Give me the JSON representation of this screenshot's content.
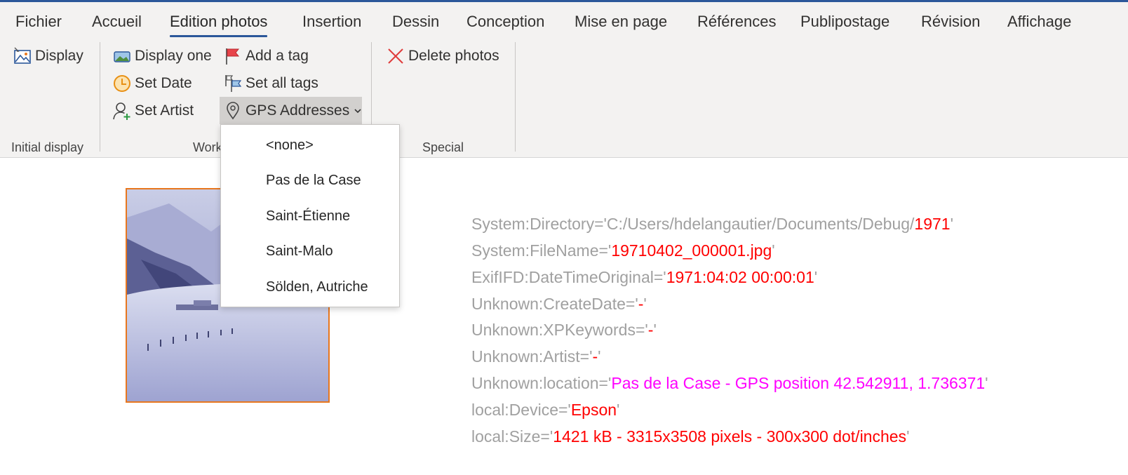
{
  "tabs": [
    "Fichier",
    "Accueil",
    "Edition photos",
    "Insertion",
    "Dessin",
    "Conception",
    "Mise en page",
    "Références",
    "Publipostage",
    "Révision",
    "Affichage"
  ],
  "active_tab": "Edition photos",
  "ribbon": {
    "display": "Display",
    "display_one": "Display one",
    "add_tag": "Add a tag",
    "set_date": "Set Date",
    "set_all_tags": "Set all tags",
    "set_artist": "Set Artist",
    "gps_addresses": "GPS Addresses",
    "delete_photos": "Delete photos",
    "group_initial": "Initial display",
    "group_work": "Work",
    "group_special": "Special"
  },
  "gps_menu": {
    "items": [
      "<none>",
      "Pas de la Case",
      "Saint-Étienne",
      "Saint-Malo",
      "Sölden, Autriche"
    ]
  },
  "metadata": [
    {
      "key": "System:Directory='",
      "value": "C:/Users/hdelangautier/Documents/Debug/",
      "value2": "1971",
      "end": "'"
    },
    {
      "key": "System:FileName='",
      "value": "19710402_000001.jpg",
      "end": "'"
    },
    {
      "key": "ExifIFD:DateTimeOriginal='",
      "value": "1971:04:02 00:00:01",
      "end": "'"
    },
    {
      "key": "Unknown:CreateDate='",
      "value": "-",
      "end": "'"
    },
    {
      "key": "Unknown:XPKeywords='",
      "value": "-",
      "end": "'"
    },
    {
      "key": "Unknown:Artist='",
      "value": "-",
      "end": "'"
    },
    {
      "key": "Unknown:location='",
      "value": "Pas de la Case - GPS position 42.542911, 1.736371",
      "end": "'"
    },
    {
      "key": "local:Device='",
      "value": "Epson",
      "end": "'"
    },
    {
      "key": "local:Size='",
      "value": "1421 kB - 3315x3508 pixels - 300x300 dot/inches",
      "end": "'"
    }
  ],
  "colors": {
    "accent": "#2b579a",
    "value_red": "#ff0000",
    "value_magenta": "#ff00ff",
    "key_gray": "#a0a0a0",
    "photo_border": "#e8771e"
  }
}
